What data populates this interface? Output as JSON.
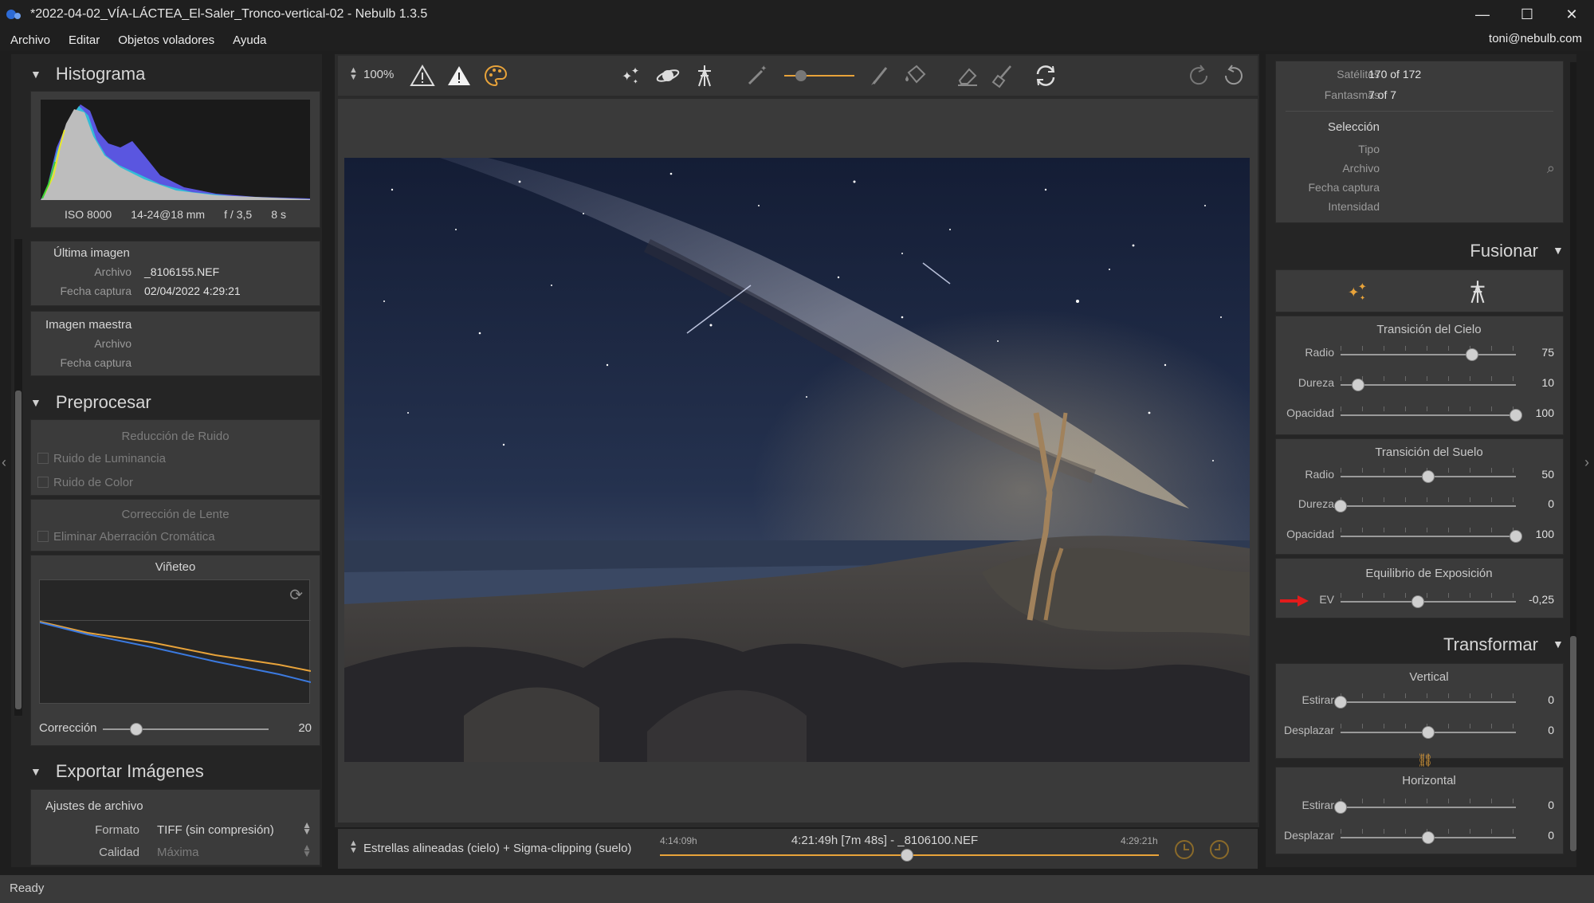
{
  "window": {
    "title": "*2022-04-02_VÍA-LÁCTEA_El-Saler_Tronco-vertical-02 - Nebulb 1.3.5",
    "min": "—",
    "max": "☐",
    "close": "✕"
  },
  "menu": {
    "items": [
      "Archivo",
      "Editar",
      "Objetos voladores",
      "Ayuda"
    ],
    "user": "toni@nebulb.com"
  },
  "histogram": {
    "title": "Histograma",
    "iso": "ISO 8000",
    "lens": "14-24@18 mm",
    "aperture": "f / 3,5",
    "shutter": "8 s"
  },
  "last_image": {
    "title": "Última imagen",
    "file_label": "Archivo",
    "file": "_8106155.NEF",
    "date_label": "Fecha captura",
    "date": "02/04/2022 4:29:21"
  },
  "master_image": {
    "title": "Imagen maestra",
    "file_label": "Archivo",
    "date_label": "Fecha captura"
  },
  "preprocess": {
    "title": "Preprocesar",
    "noise_title": "Reducción de Ruido",
    "lum_noise": "Ruido de Luminancia",
    "color_noise": "Ruido de Color",
    "lens_title": "Corrección de Lente",
    "chrom_ab": "Eliminar Aberración Cromática",
    "vignette_title": "Viñeteo",
    "correction_label": "Corrección",
    "correction_value": "20",
    "correction_level": 0.2
  },
  "export": {
    "title": "Exportar Imágenes",
    "file_settings": "Ajustes de archivo",
    "format_label": "Formato",
    "format_value": "TIFF (sin compresión)",
    "quality_label": "Calidad",
    "quality_value": "Máxima"
  },
  "toolbar": {
    "zoom": "100%"
  },
  "bottom": {
    "mode": "Estrellas alineadas (cielo) + Sigma-clipping (suelo)",
    "time_start": "4:14:09h",
    "time_current": "4:21:49h [7m 48s] - _8106100.NEF",
    "time_end": "4:29:21h",
    "timeline_position": 0.496
  },
  "info": {
    "satellites_label": "Satélites",
    "satellites": "170 of 172",
    "ghosts_label": "Fantasmas",
    "ghosts": "7 of 7",
    "selection_title": "Selección",
    "type_label": "Tipo",
    "file_label": "Archivo",
    "date_label": "Fecha captura",
    "intensity_label": "Intensidad"
  },
  "merge": {
    "title": "Fusionar",
    "sky_title": "Transición del Cielo",
    "sky": [
      {
        "label": "Radio",
        "value": "75",
        "level": 0.75
      },
      {
        "label": "Dureza",
        "value": "10",
        "level": 0.1
      },
      {
        "label": "Opacidad",
        "value": "100",
        "level": 1.0
      }
    ],
    "ground_title": "Transición del Suelo",
    "ground": [
      {
        "label": "Radio",
        "value": "50",
        "level": 0.5
      },
      {
        "label": "Dureza",
        "value": "0",
        "level": 0.0
      },
      {
        "label": "Opacidad",
        "value": "100",
        "level": 1.0
      }
    ],
    "exposure_title": "Equilibrio de Exposición",
    "ev_label": "EV",
    "ev_value": "-0,25",
    "ev_level": 0.44
  },
  "transform": {
    "title": "Transformar",
    "vertical_title": "Vertical",
    "vertical": [
      {
        "label": "Estirar",
        "value": "0",
        "level": 0.0
      },
      {
        "label": "Desplazar",
        "value": "0",
        "level": 0.5
      }
    ],
    "horizontal_title": "Horizontal",
    "horizontal": [
      {
        "label": "Estirar",
        "value": "0",
        "level": 0.0
      },
      {
        "label": "Desplazar",
        "value": "0",
        "level": 0.5
      }
    ]
  },
  "status": "Ready",
  "colors": {
    "accent": "#e8a33a",
    "arrow": "#e21b1b",
    "panel": "#3b3b3b"
  }
}
